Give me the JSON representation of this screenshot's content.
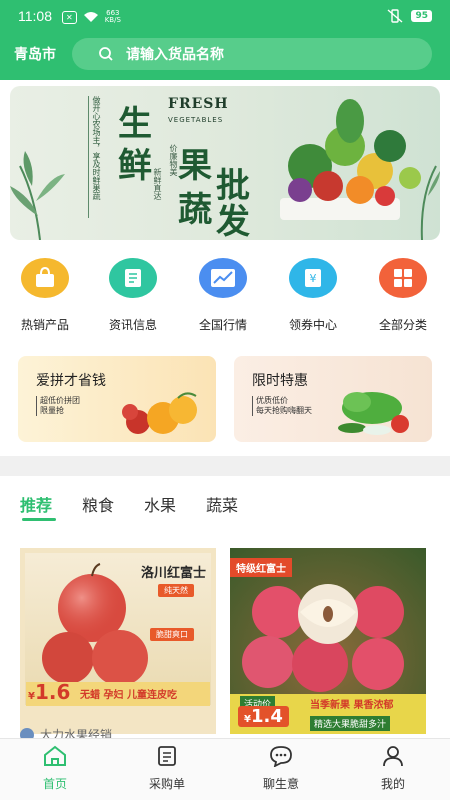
{
  "status_bar": {
    "time": "11:08",
    "network_speed_top": "663",
    "network_speed_unit": "KB/S",
    "battery": "95"
  },
  "header": {
    "city": "青岛市",
    "search_placeholder": "请输入货品名称"
  },
  "banner": {
    "vertical_line1": "做开心农场主，享及时鲜果蔬",
    "vertical_line2": "新鲜直达",
    "vertical_line3": "价廉物美",
    "big_char1": "生",
    "big_char2": "鲜",
    "big_char3": "果",
    "big_char4": "蔬",
    "big_char5": "批",
    "big_char6": "发",
    "fresh": "FRESH",
    "vegetables": "VEGETABLES"
  },
  "categories": [
    {
      "label": "热销产品",
      "icon": "shopping-bag-icon",
      "color": "#f5b82e"
    },
    {
      "label": "资讯信息",
      "icon": "news-icon",
      "color": "#2fc6a0"
    },
    {
      "label": "全国行情",
      "icon": "trend-chart-icon",
      "color": "#4b8ef0"
    },
    {
      "label": "领券中心",
      "icon": "coupon-icon",
      "color": "#2fb6e8"
    },
    {
      "label": "全部分类",
      "icon": "grid-icon",
      "color": "#f2623a"
    }
  ],
  "promos": [
    {
      "title": "爱拼才省钱",
      "sub1": "超低价拼团",
      "sub2": "限量抢"
    },
    {
      "title": "限时特惠",
      "sub1": "优质低价",
      "sub2": "每天抢购嗨翻天"
    }
  ],
  "tabs": [
    {
      "label": "推荐",
      "active": true
    },
    {
      "label": "粮食"
    },
    {
      "label": "水果"
    },
    {
      "label": "蔬菜"
    }
  ],
  "products": [
    {
      "title": "洛川红富士",
      "tag1": "纯天然",
      "tag2": "脆甜爽口",
      "price_symbol": "¥",
      "price": "1.6",
      "slogan": "无蜡 孕妇 儿童连皮吃"
    },
    {
      "title": "特级红富士",
      "promo_label": "活动价",
      "price_symbol": "¥",
      "price": "1.4",
      "banner1": "当季新果  果香浓郁",
      "banner2": "精选大果脆甜多汁"
    }
  ],
  "shop": {
    "name": "大力水果经销"
  },
  "bottom_nav": [
    {
      "label": "首页",
      "icon": "home-icon",
      "active": true
    },
    {
      "label": "采购单",
      "icon": "order-list-icon"
    },
    {
      "label": "聊生意",
      "icon": "chat-icon"
    },
    {
      "label": "我的",
      "icon": "user-icon"
    }
  ],
  "colors": {
    "brand_green": "#2fbf71",
    "search_bg": "#57cd8b"
  }
}
